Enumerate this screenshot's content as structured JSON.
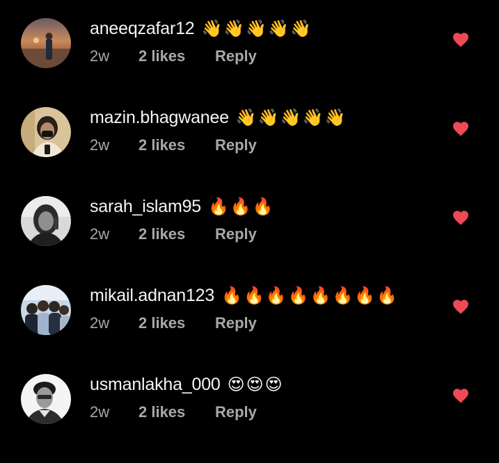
{
  "comments": [
    {
      "username": "aneeqzafar12",
      "text": "👋👋👋👋👋",
      "time": "2w",
      "likes": "2 likes",
      "reply": "Reply"
    },
    {
      "username": "mazin.bhagwanee",
      "text": "👋👋👋👋👋",
      "time": "2w",
      "likes": "2 likes",
      "reply": "Reply"
    },
    {
      "username": "sarah_islam95",
      "text": "🔥🔥🔥",
      "time": "2w",
      "likes": "2 likes",
      "reply": "Reply"
    },
    {
      "username": "mikail.adnan123",
      "text": "🔥🔥🔥🔥🔥🔥🔥🔥",
      "time": "2w",
      "likes": "2 likes",
      "reply": "Reply"
    },
    {
      "username": "usmanlakha_000",
      "text": "😍😍😍",
      "time": "2w",
      "likes": "2 likes",
      "reply": "Reply"
    }
  ],
  "colors": {
    "background": "#000000",
    "text": "#f5f5f5",
    "secondary": "#a8a8a8",
    "like": "#ed4956"
  },
  "icons": {
    "like": "heart-filled-icon"
  }
}
